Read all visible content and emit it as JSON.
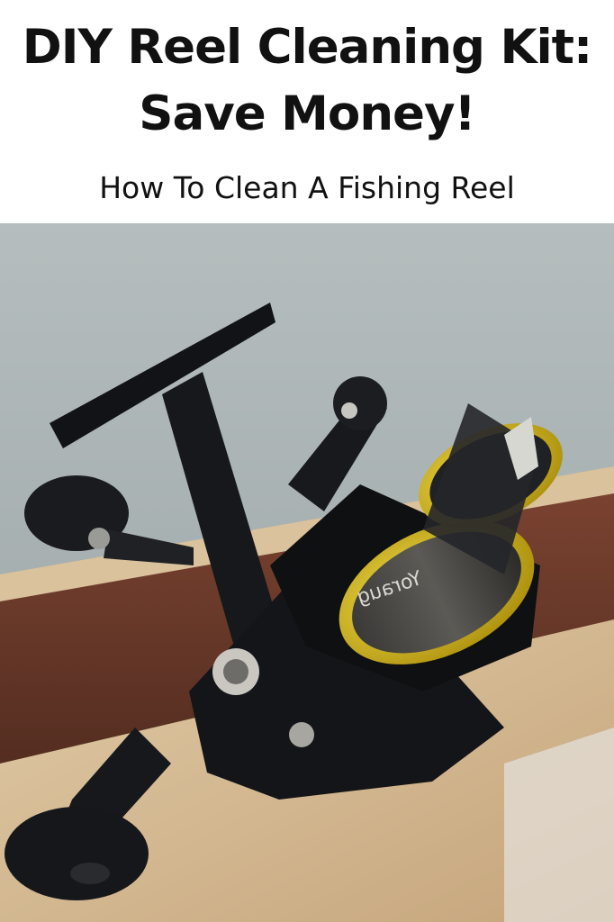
{
  "header": {
    "title_line1": "DIY Reel Cleaning Kit:",
    "title_line2": "Save Money!",
    "subtitle": "How To Clean A Fishing Reel"
  },
  "photo": {
    "spool_text": "Yoraug",
    "colors": {
      "water": "#a9b2b4",
      "boat_wood": "#c9ad87",
      "boat_rim": "#6a3a2a",
      "reel_body": "#141518",
      "spool_gold": "#d6b80f"
    }
  }
}
